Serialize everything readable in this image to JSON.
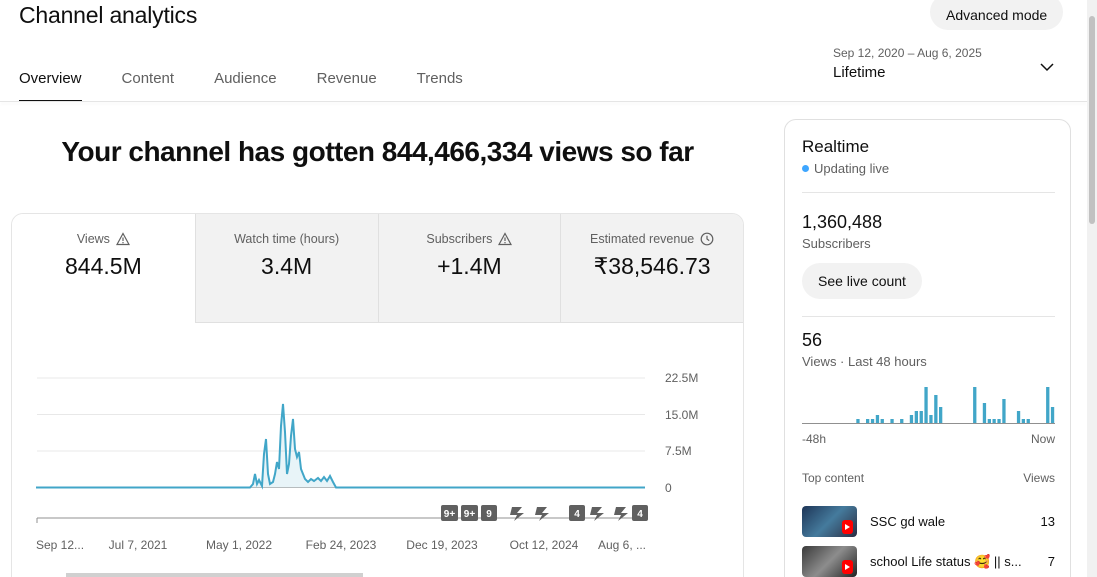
{
  "header": {
    "title": "Channel analytics",
    "advanced_mode": "Advanced mode",
    "tabs": [
      {
        "label": "Overview",
        "active": true
      },
      {
        "label": "Content"
      },
      {
        "label": "Audience"
      },
      {
        "label": "Revenue"
      },
      {
        "label": "Trends"
      }
    ],
    "date_range": "Sep 12, 2020 – Aug 6, 2025",
    "date_label": "Lifetime"
  },
  "headline": "Your channel has gotten 844,466,334 views so far",
  "metrics": [
    {
      "label": "Views",
      "value": "844.5M",
      "icon": "warning-icon"
    },
    {
      "label": "Watch time (hours)",
      "value": "3.4M"
    },
    {
      "label": "Subscribers",
      "value": "+1.4M",
      "icon": "warning-icon"
    },
    {
      "label": "Estimated revenue",
      "value": "₹38,546.73",
      "icon": "clock-icon"
    }
  ],
  "chart": {
    "y_ticks": [
      "22.5M",
      "15.0M",
      "7.5M",
      "0"
    ],
    "x_ticks": [
      "Sep 12...",
      "Jul 7, 2021",
      "May 1, 2022",
      "Feb 24, 2023",
      "Dec 19, 2023",
      "Oct 12, 2024",
      "Aug 6, ..."
    ],
    "markers": [
      "9+",
      "9+",
      "9",
      "shorts",
      "shorts",
      "4",
      "shorts",
      "shorts",
      "4"
    ],
    "line_color": "#41a6c8"
  },
  "realtime": {
    "title": "Realtime",
    "live": "Updating live",
    "subscribers": "1,360,488",
    "subscribers_label": "Subscribers",
    "live_count_button": "See live count",
    "views": "56",
    "views_label": "Views · Last 48 hours",
    "range_start": "-48h",
    "range_end": "Now",
    "bars": [
      0,
      0,
      0,
      0,
      0,
      0,
      0,
      0,
      0,
      0,
      0,
      1,
      0,
      1,
      1,
      2,
      1,
      0,
      1,
      0,
      1,
      0,
      2,
      3,
      3,
      9,
      2,
      7,
      4,
      0,
      0,
      0,
      0,
      0,
      0,
      9,
      0,
      5,
      1,
      1,
      1,
      6,
      0,
      0,
      3,
      1,
      1,
      0,
      0,
      0,
      9,
      4
    ],
    "bar_color": "#41a6c8",
    "top_content_label": "Top content",
    "top_views_label": "Views",
    "top_content": [
      {
        "title": "SSC gd wale",
        "views": "13"
      },
      {
        "title": "school Life status 🥰 || s...",
        "views": "7"
      }
    ]
  }
}
